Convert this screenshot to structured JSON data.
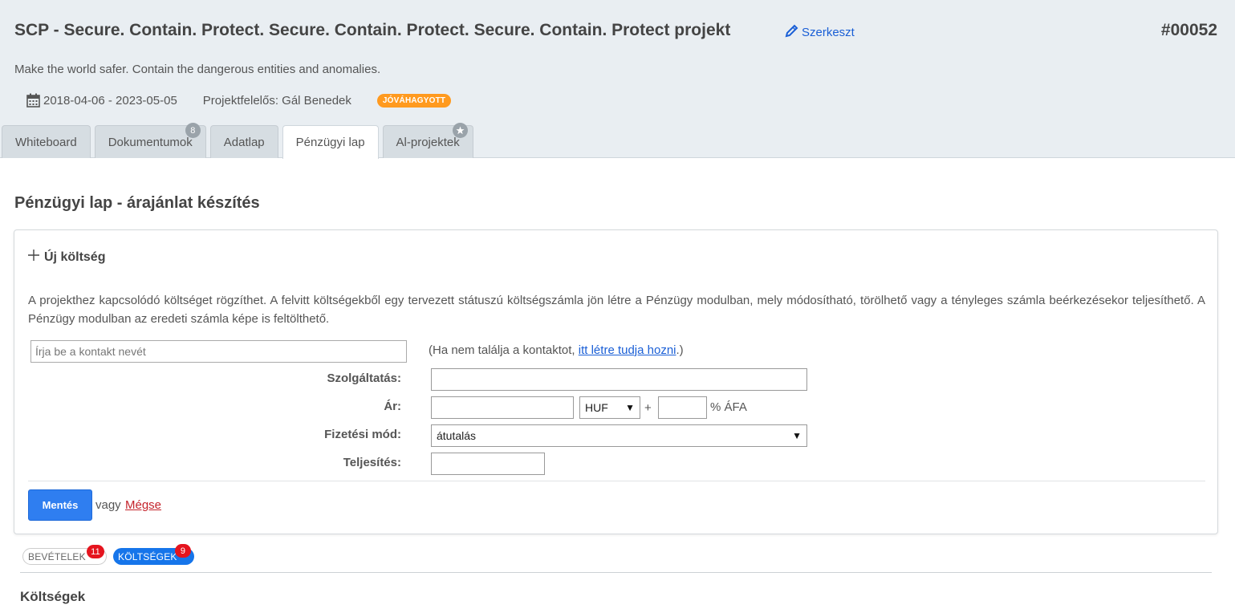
{
  "project": {
    "title": "SCP - Secure. Contain. Protect. Secure. Contain. Protect. Secure. Contain. Protect projekt",
    "edit_label": "Szerkeszt",
    "id": "#00052",
    "description": "Make the world safer. Contain the dangerous entities and anomalies.",
    "date_range": "2018-04-06 - 2023-05-05",
    "owner": "Projektfelelős: Gál Benedek",
    "status": "JÓVÁHAGYOTT",
    "status_color": "#ff9a1f"
  },
  "tabs": [
    {
      "label": "Whiteboard",
      "badge": ""
    },
    {
      "label": "Dokumentumok",
      "badge": "8"
    },
    {
      "label": "Adatlap",
      "badge": ""
    },
    {
      "label": "Pénzügyi lap",
      "badge": "",
      "active": true
    },
    {
      "label": "Al-projektek",
      "badge_icon": "star-icon"
    }
  ],
  "page_title": "Pénzügyi lap - árajánlat készítés",
  "new_cost": {
    "heading": "Új költség",
    "description": "A projekthez kapcsolódó költséget rögzíthet. A felvitt költségekből egy tervezett státuszú költségszámla jön létre a Pénzügy modulban, mely módosítható, törölhető vagy a tényleges számla beérkezésekor teljesíthető. A Pénzügy modulban az eredeti számla képe is feltölthető.",
    "contact_placeholder": "Írja be a kontakt nevét",
    "contact_hint_prefix": "(Ha nem találja a kontaktot, ",
    "contact_hint_link": "itt létre tudja hozni",
    "contact_hint_suffix": ".)",
    "service_label": "Szolgáltatás:",
    "service_value": "",
    "price_label": "Ár:",
    "price_value": "",
    "currency": "HUF",
    "plus": "+",
    "vat_value": "",
    "vat_suffix": "% ÁFA",
    "payment_label": "Fizetési mód:",
    "payment_value": "átutalás",
    "completion_label": "Teljesítés:",
    "completion_value": "",
    "save_label": "Mentés",
    "or_label": "vagy",
    "cancel_label": "Mégse"
  },
  "filters": {
    "income_label": "BEVÉTELEK",
    "income_count": "11",
    "cost_label": "KÖLTSÉGEK",
    "cost_count": "9",
    "accent": "#1675ea",
    "count_color": "#e5141e"
  },
  "section_title": "Költségek"
}
